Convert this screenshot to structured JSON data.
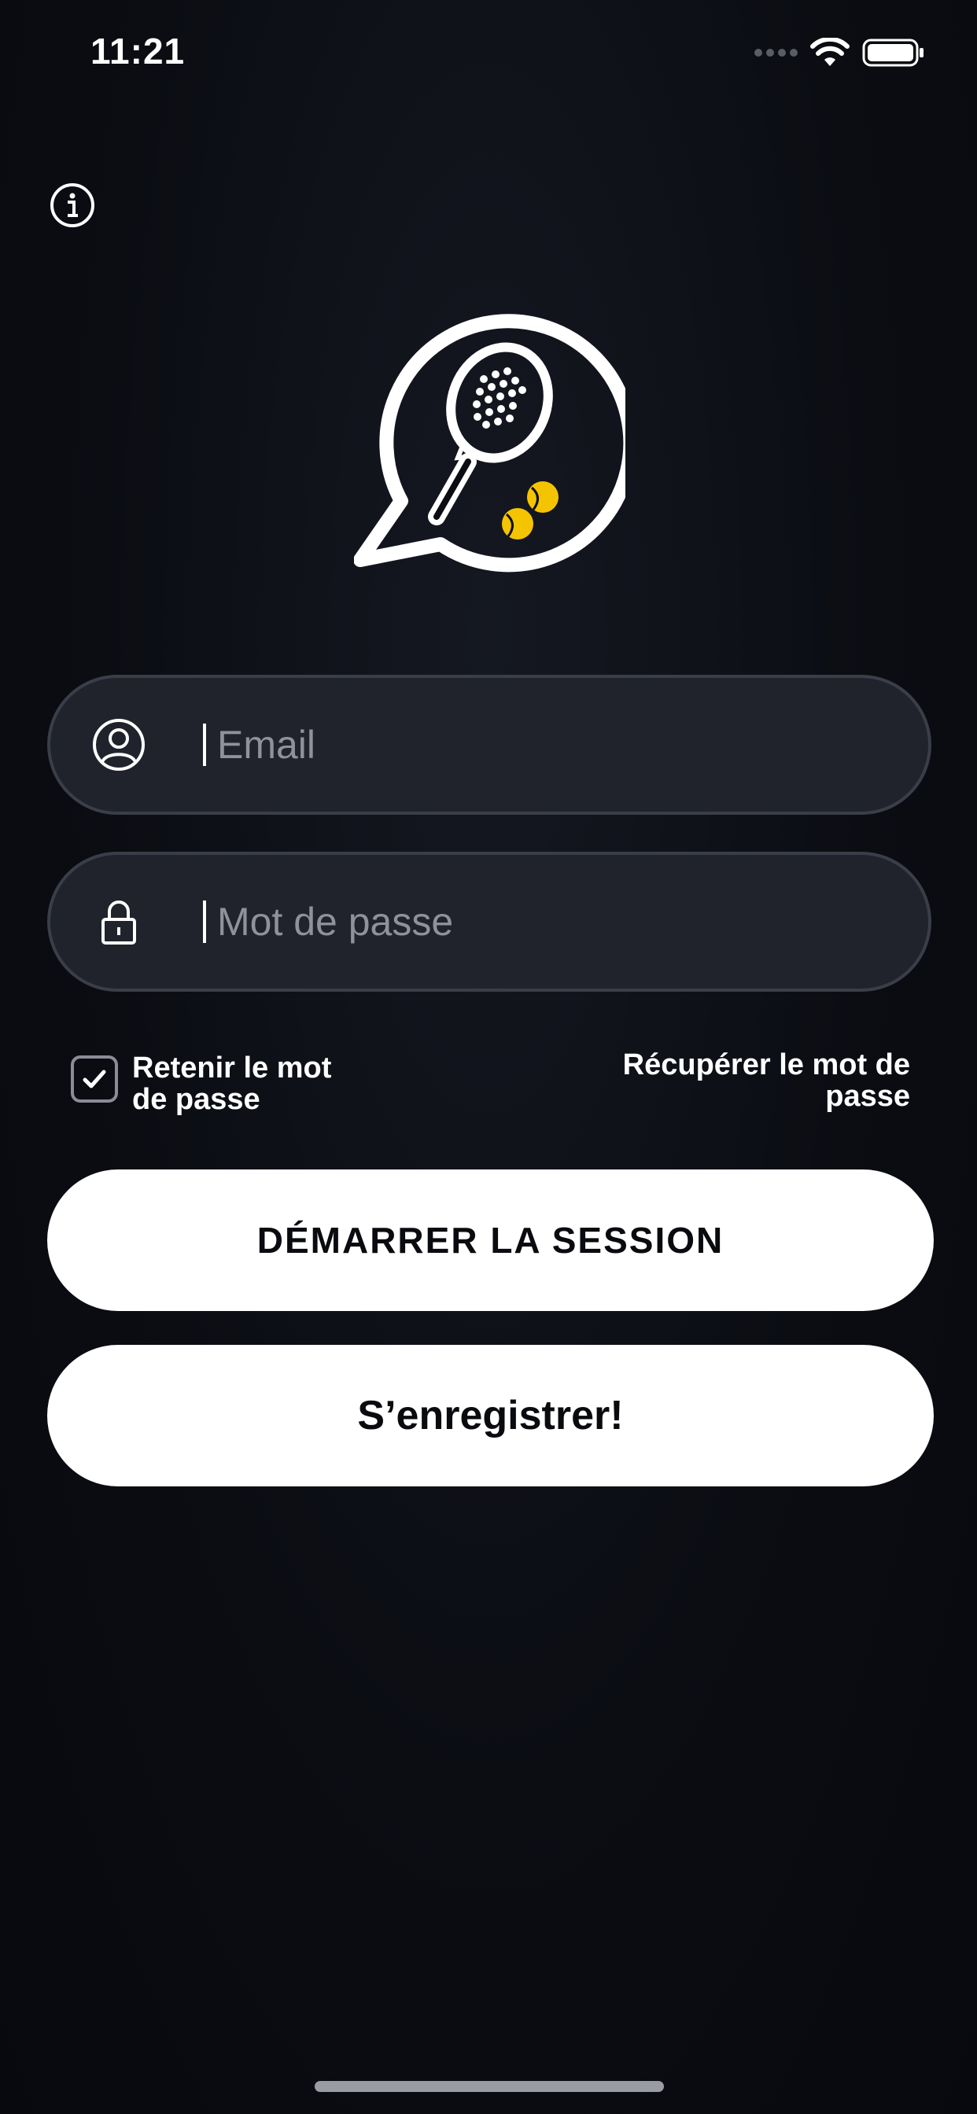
{
  "status_bar": {
    "time": "11:21",
    "icons": [
      "signal-dots-icon",
      "wifi-icon",
      "battery-icon"
    ]
  },
  "header": {
    "info_icon": "info-icon"
  },
  "logo": {
    "icon": "padel-racket-chat-logo",
    "colors": {
      "outline": "#ffffff",
      "balls": "#f5c400"
    }
  },
  "form": {
    "email": {
      "placeholder": "Email",
      "value": "",
      "icon": "user-icon"
    },
    "password": {
      "placeholder": "Mot de passe",
      "value": "",
      "icon": "lock-icon"
    },
    "remember": {
      "label": "Retenir le mot de passe",
      "checked": true
    },
    "recover_label": "Récupérer le mot de passe"
  },
  "buttons": {
    "login": "DÉMARRER LA SESSION",
    "register": "S’enregistrer!"
  },
  "colors": {
    "background": "#0b0d13",
    "field_bg": "#20232c",
    "field_border": "#3a3e49",
    "button_bg": "#ffffff",
    "button_text": "#0a0b0f"
  }
}
